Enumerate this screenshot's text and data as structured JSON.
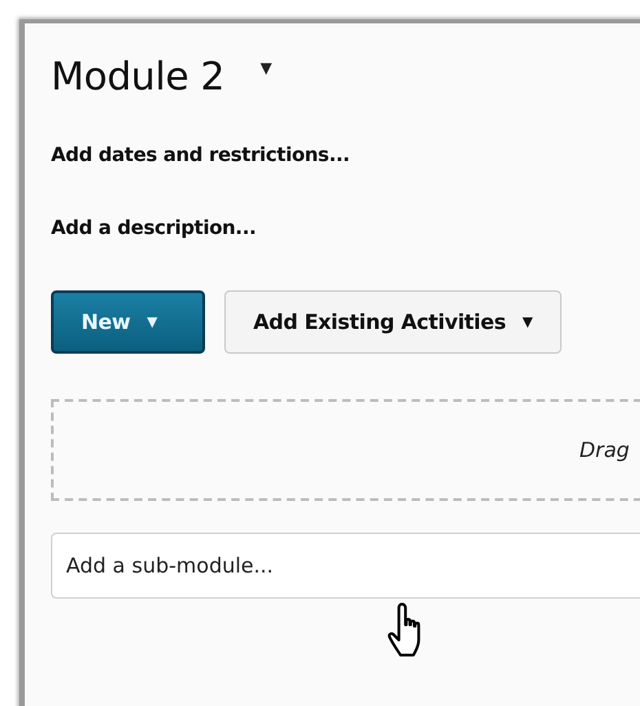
{
  "module": {
    "title": "Module 2",
    "menu_caret": "▼"
  },
  "links": [
    "Add dates and restrictions...",
    "Add a description..."
  ],
  "buttons": [
    {
      "label": "New",
      "kind": "primary",
      "caret": "▼"
    },
    {
      "label": "Add Existing Activities",
      "kind": "secondary",
      "caret": "▼"
    }
  ],
  "drop_zone": {
    "text": "Drag"
  },
  "sub_module_field": {
    "placeholder": "Add a sub-module..."
  }
}
